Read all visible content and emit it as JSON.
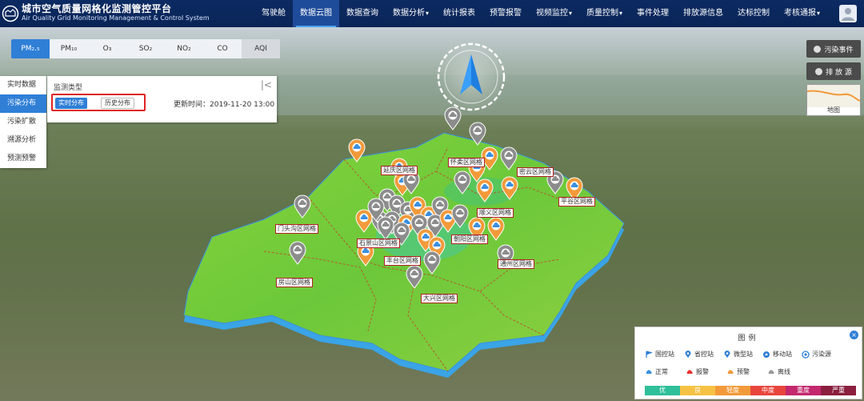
{
  "header": {
    "logo_cn": "城市空气质量网格化监测管控平台",
    "logo_en": "Air Quality Grid Monitoring Management & Control System",
    "nav": [
      {
        "label": "驾驶舱",
        "caret": false,
        "active": false
      },
      {
        "label": "数据云图",
        "caret": false,
        "active": true
      },
      {
        "label": "数据查询",
        "caret": false,
        "active": false
      },
      {
        "label": "数据分析",
        "caret": true,
        "active": false
      },
      {
        "label": "统计报表",
        "caret": false,
        "active": false
      },
      {
        "label": "预警报警",
        "caret": false,
        "active": false
      },
      {
        "label": "视频监控",
        "caret": true,
        "active": false
      },
      {
        "label": "质量控制",
        "caret": true,
        "active": false
      },
      {
        "label": "事件处理",
        "caret": false,
        "active": false
      },
      {
        "label": "排放源信息",
        "caret": false,
        "active": false
      },
      {
        "label": "达标控制",
        "caret": false,
        "active": false
      },
      {
        "label": "考核通报",
        "caret": true,
        "active": false
      }
    ],
    "caret_glyph": "▾"
  },
  "pollutants": {
    "tabs": [
      "PM₂.₅",
      "PM₁₀",
      "O₃",
      "SO₂",
      "NO₂",
      "CO",
      "AQI"
    ],
    "active": 0
  },
  "left_menu": {
    "items": [
      "实时数据",
      "污染分布",
      "污染扩散",
      "溯源分析",
      "预测预警"
    ],
    "active": 1
  },
  "monitor_panel": {
    "title": "监测类型",
    "collapse_glyph": "|<",
    "realtime_label": "实时分布",
    "history_label": "历史分布",
    "update_time": "更新时间：2019-11-20 13:00"
  },
  "right_controls": {
    "pollution_event": "污染事件",
    "emission_source": "排 放 源",
    "map_label": "地图"
  },
  "legend": {
    "title": "图例",
    "close_glyph": "×",
    "station_types": [
      "国控站",
      "省控站",
      "微型站",
      "移动站",
      "污染源"
    ],
    "status_types": [
      "正常",
      "报警",
      "预警",
      "离线"
    ],
    "status_colors": [
      "#3a8fe0",
      "#e83030",
      "#f29a3a",
      "#999999"
    ],
    "levels": [
      "优",
      "良",
      "轻度",
      "中度",
      "重度",
      "严重"
    ],
    "level_colors": [
      "#2fbf9a",
      "#f6c244",
      "#f29a3a",
      "#e8453c",
      "#c4286e",
      "#8a1f3e"
    ]
  },
  "map_labels": [
    "延庆区网格",
    "怀柔区网格",
    "密云区网格",
    "平谷区网格",
    "顺义区网格",
    "门头沟区网格",
    "石景山区网格",
    "朝阳区网格",
    "丰台区网格",
    "通州区网格",
    "房山区网格",
    "大兴区网格"
  ]
}
